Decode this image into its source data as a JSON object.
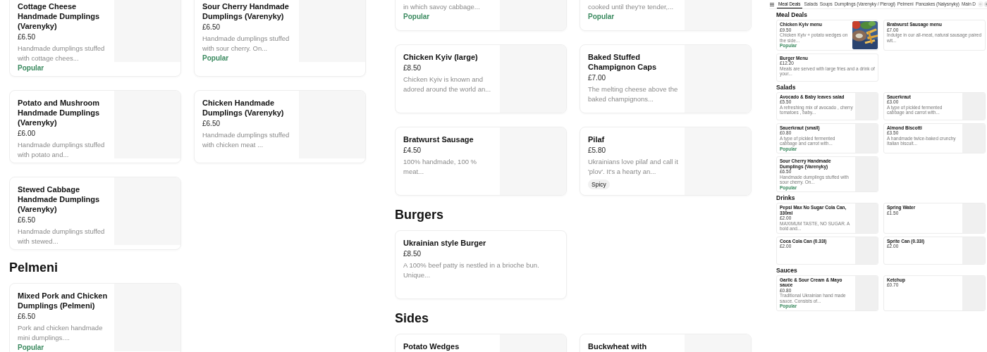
{
  "menu_panels": [
    {
      "sections": [
        {
          "items": [
            {
              "name": "Cottage Cheese Handmade Dumplings (Varenyky)",
              "price": "£6.50",
              "description": "Handmade dumplings stuffed with cottage chees...",
              "badge": "Popular"
            },
            {
              "name": "Sour Cherry Handmade Dumplings (Varenyky)",
              "price": "£6.50",
              "description": "Handmade dumplings stuffed with sour cherry. On...",
              "badge": "Popular"
            },
            {
              "name": "Potato and Mushroom Handmade Dumplings (Varenyky)",
              "price": "£6.00",
              "description": "Handmade dumplings stuffed with potato and..."
            },
            {
              "name": "Chicken Handmade Dumplings (Varenyky)",
              "price": "£6.50",
              "description": "Handmade dumplings stuffed with chicken meat ..."
            },
            {
              "name": "Stewed Cabbage Handmade Dumplings (Varenyky)",
              "price": "£6.50",
              "description": "Handmade dumplings stuffed with stewed..."
            }
          ]
        },
        {
          "heading": "Pelmeni",
          "items": [
            {
              "name": "Mixed Pork and Chicken Dumplings (Pelmeni)",
              "price": "£6.50",
              "description": "Pork and chicken handmade mini dumplings....",
              "badge": "Popular"
            }
          ]
        }
      ]
    },
    {
      "sections": [
        {
          "items": [
            {
              "description": "in which savoy cabbage...",
              "badge": "Popular"
            },
            {
              "description": "cooked until they're tender,...",
              "badge": "Popular"
            },
            {
              "name": "Chicken Kyiv (large)",
              "price": "£8.50",
              "description": "Chicken Kyiv is known and adored around the world an..."
            },
            {
              "name": "Baked Stuffed Champignon Caps",
              "price": "£7.00",
              "description": "The melting cheese above the baked champignons..."
            },
            {
              "name": "Bratwurst Sausage",
              "price": "£4.50",
              "description": "100% handmade, 100 % meat..."
            },
            {
              "name": "Pilaf",
              "price": "£5.80",
              "description": "Ukrainians love pilaf and call it 'plov'. It's a hearty an...",
              "tag": "Spicy"
            }
          ]
        },
        {
          "heading": "Burgers",
          "items": [
            {
              "name": "Ukrainian style Burger",
              "price": "£8.50",
              "description": "A 100% beef patty is nestled in a brioche bun. Unique...",
              "photo_area": false
            }
          ]
        },
        {
          "heading": "Sides",
          "items": [
            {
              "name": "Potato Wedges"
            },
            {
              "name": "Buckwheat with"
            }
          ]
        }
      ]
    }
  ],
  "preview": {
    "tabs": [
      {
        "label": "Meal Deals",
        "selected": true
      },
      {
        "label": "Salads",
        "selected": false
      },
      {
        "label": "Soups",
        "selected": false
      },
      {
        "label": "Dumplings (Varenyky / Pierogi)",
        "selected": false
      },
      {
        "label": "Pelmeni",
        "selected": false
      },
      {
        "label": "Pancakes (Nalysnyky)",
        "selected": false
      },
      {
        "label": "Main D",
        "selected": false
      }
    ],
    "scroll_buttons": [
      {
        "disabled": true
      },
      {
        "disabled": false
      }
    ],
    "sections": [
      {
        "heading": "Meal Deals",
        "items": [
          {
            "name": "Chicken Kyiv menu",
            "price": "£9.50",
            "description": "Chicken Kyiv + potato wedges on the side...",
            "badge": "Popular",
            "photo": true
          },
          {
            "name": "Bratwurst Sausage menu",
            "price": "£7.00",
            "description": "Indulge in our all-meat, natural sausage paired wit...",
            "photo_area": false
          },
          {
            "name": "Burger Menu",
            "price": "£12.20",
            "description": "Meals are served with large fries and a drink of your...",
            "photo_area": false
          }
        ]
      },
      {
        "heading": "Salads",
        "items": [
          {
            "name": "Avocado & Baby leaves salad",
            "price": "£5.50",
            "description": "A refreshing mix of avocado , cherry tomatoes , baby..."
          },
          {
            "name": "Sauerkraut",
            "price": "£3.00",
            "description": "A type of pickled fermented cabbage and carrot with..."
          },
          {
            "name": "Sauerkraut (small)",
            "price": "£0.80",
            "description": "A type of pickled fermented cabbage and carrot with...",
            "badge": "Popular"
          },
          {
            "name": "Almond Biscotti",
            "price": "£3.50",
            "description": "A handmade twice-baked crunchy Italian biscuit..."
          },
          {
            "name": "Sour Cherry Handmade Dumplings (Varenyky)",
            "price": "£6.50",
            "description": "Handmade dumplings stuffed with sour cherry. On...",
            "badge": "Popular"
          }
        ]
      },
      {
        "heading": "Drinks",
        "items": [
          {
            "name": "Pepsi Max No Sugar Cola Can, 330ml",
            "price": "£2.00",
            "description": "MAXIMUM TASTE, NO SUGAR. A bold and..."
          },
          {
            "name": "Spring Water",
            "price": "£1.50"
          },
          {
            "name": "Coca Cola Can (0.33l)",
            "price": "£2.00"
          },
          {
            "name": "Sprite  Can (0.33l)",
            "price": "£2.00"
          }
        ]
      },
      {
        "heading": "Sauces",
        "items": [
          {
            "name": "Garlic & Sour Cream & Mayo sauce",
            "price": "£0.80",
            "description": "Traditional Ukrainian hand made sauce. Consists of...",
            "badge": "Popular"
          },
          {
            "name": "Ketchup",
            "price": "£0.70"
          }
        ]
      }
    ]
  }
}
